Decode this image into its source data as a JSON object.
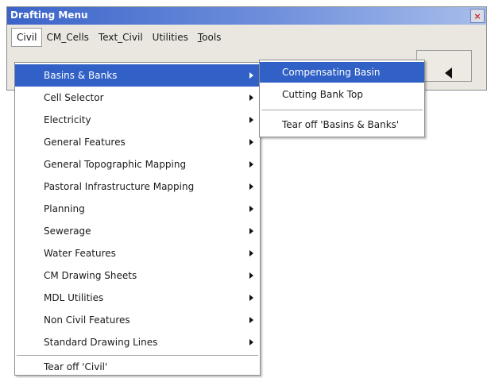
{
  "window": {
    "title": "Drafting Menu",
    "close_glyph": "×"
  },
  "menubar": {
    "items": [
      {
        "label": "Civil"
      },
      {
        "label": "CM_Cells"
      },
      {
        "label": "Text_Civil"
      },
      {
        "label": "Utilities"
      },
      {
        "label": "Tools",
        "accel": "T",
        "rest": "ools"
      }
    ],
    "active_index": 0
  },
  "main_menu": {
    "items": [
      {
        "label": "Basins & Banks",
        "submenu": true,
        "selected": true
      },
      {
        "label": "Cell Selector",
        "submenu": true
      },
      {
        "label": "Electricity",
        "submenu": true
      },
      {
        "label": "General Features",
        "submenu": true
      },
      {
        "label": "General Topographic Mapping",
        "submenu": true
      },
      {
        "label": "Pastoral Infrastructure Mapping",
        "submenu": true
      },
      {
        "label": "Planning",
        "submenu": true
      },
      {
        "label": "Sewerage",
        "submenu": true
      },
      {
        "label": "Water Features",
        "submenu": true
      },
      {
        "label": "CM Drawing Sheets",
        "submenu": true
      },
      {
        "label": "MDL Utilities",
        "submenu": true
      },
      {
        "label": "Non Civil Features",
        "submenu": true
      },
      {
        "label": "Standard Drawing Lines",
        "submenu": true
      }
    ],
    "tear_off": "Tear off 'Civil'"
  },
  "sub_menu": {
    "items": [
      {
        "label": "Compensating Basin",
        "selected": true
      },
      {
        "label": "Cutting Bank Top"
      }
    ],
    "tear_off": "Tear off 'Basins & Banks'"
  },
  "colors": {
    "selection": "#3161c6",
    "titlebar_start": "#3b64c9",
    "titlebar_end": "#a8bdeb",
    "window_bg": "#e9e7e0"
  },
  "icons": {
    "close": "close-icon",
    "submenu_arrow": "chevron-right-icon",
    "frame_arrow": "triangle-left-icon"
  }
}
